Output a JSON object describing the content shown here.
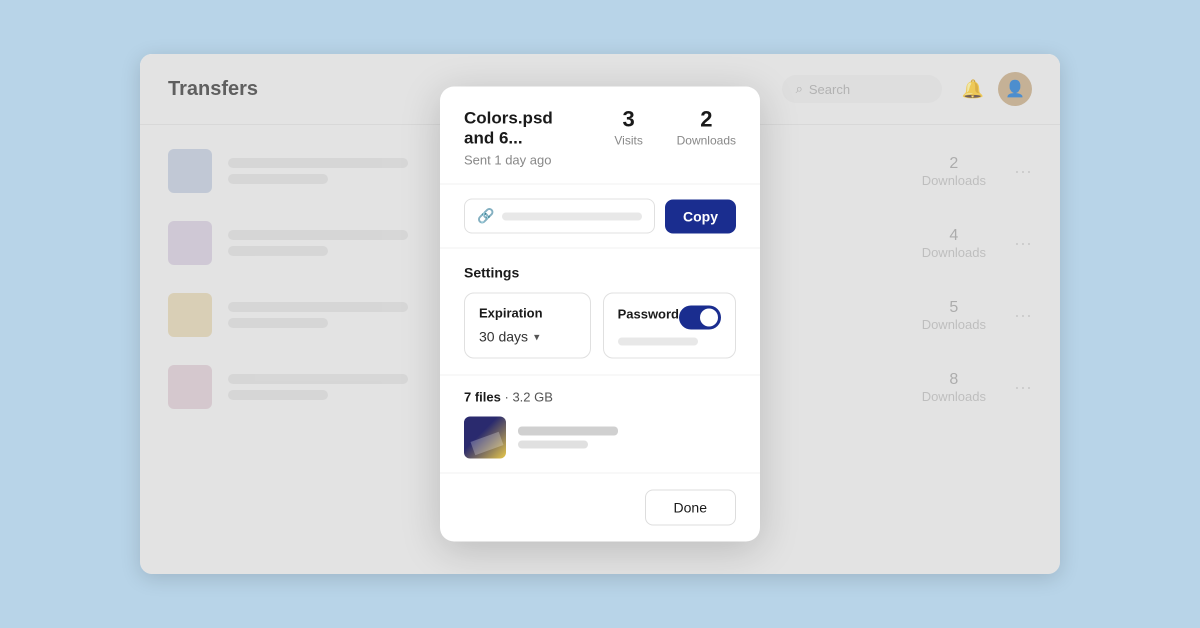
{
  "app": {
    "title": "Transfers",
    "search_placeholder": "Search"
  },
  "modal": {
    "title": "Colors.psd and 6...",
    "subtitle": "Sent 1 day ago",
    "visits_label": "Visits",
    "visits_count": "3",
    "downloads_label": "Downloads",
    "downloads_count": "2",
    "copy_button_label": "Copy",
    "settings_label": "Settings",
    "expiration_label": "Expiration",
    "expiration_value": "30 days",
    "password_label": "Password",
    "files_count": "7 files",
    "files_size": "3.2 GB",
    "done_button_label": "Done"
  },
  "table_rows": [
    {
      "id": 1,
      "downloads_count": "2",
      "downloads_label": "Downloads",
      "thumb_color": "blue"
    },
    {
      "id": 2,
      "downloads_count": "4",
      "downloads_label": "Downloads",
      "thumb_color": "purple"
    },
    {
      "id": 3,
      "downloads_count": "5",
      "downloads_label": "Downloads",
      "thumb_color": "yellow"
    },
    {
      "id": 4,
      "downloads_count": "8",
      "downloads_label": "Downloads",
      "thumb_color": "mauve"
    }
  ]
}
